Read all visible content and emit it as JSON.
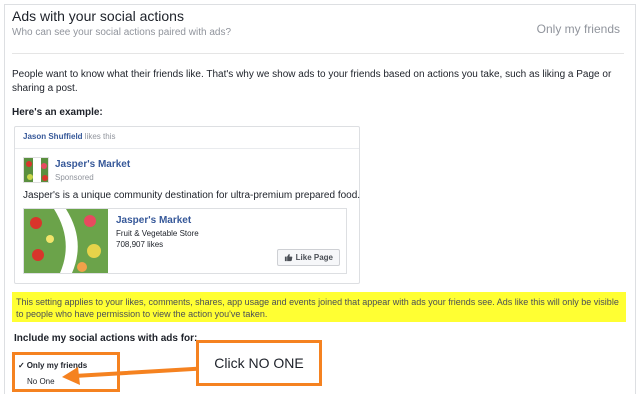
{
  "header": {
    "title": "Ads with your social actions",
    "subtitle": "Who can see your social actions paired with ads?",
    "current_value": "Only my friends"
  },
  "description": "People want to know what their friends like. That's why we show ads to your friends based on actions you take, such as liking a Page or sharing a post.",
  "example": {
    "heading": "Here's an example:",
    "friend_name": "Jason Shuffield",
    "friend_action": "likes this",
    "page_name": "Jasper's Market",
    "sponsored": "Sponsored",
    "post_text": "Jasper's is a unique community destination for ultra-premium prepared food.",
    "link_name": "Jasper's Market",
    "link_category": "Fruit & Vegetable Store",
    "link_likes": "708,907 likes",
    "like_button": "Like Page"
  },
  "notice": "This setting applies to your likes, comments, shares, app usage and events joined that appear with ads your friends see. Ads like this will only be visible to people who have permission to view the action you've taken.",
  "include_label": "Include my social actions with ads for:",
  "dropdown": {
    "check": "✓",
    "selected": "Only my friends",
    "other": "No One"
  },
  "callout": "Click NO ONE",
  "colors": {
    "highlight": "#ffff33",
    "annotation": "#f58220",
    "link": "#365899"
  }
}
